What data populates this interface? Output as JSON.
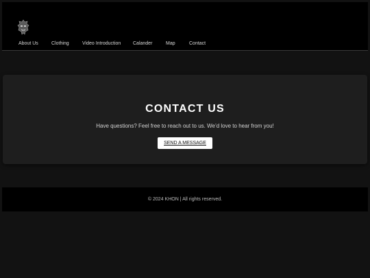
{
  "header": {
    "logo_icon": "demon-mask-logo-icon",
    "nav": [
      {
        "label": "About Us"
      },
      {
        "label": "Clothing"
      },
      {
        "label": "Video Introduction"
      },
      {
        "label": "Calander"
      },
      {
        "label": "Map"
      },
      {
        "label": "Contact"
      }
    ]
  },
  "contact": {
    "title": "CONTACT US",
    "text": "Have questions? Feel free to reach out to us. We’d love to hear from you!",
    "button_label": "SEND A MESSAGE"
  },
  "footer": {
    "text": "© 2024 KHON | All rights reserved."
  },
  "colors": {
    "page_bg": "#121212",
    "header_bg": "#000000",
    "card_bg": "#1e1e1e",
    "button_bg": "#ffffff"
  }
}
